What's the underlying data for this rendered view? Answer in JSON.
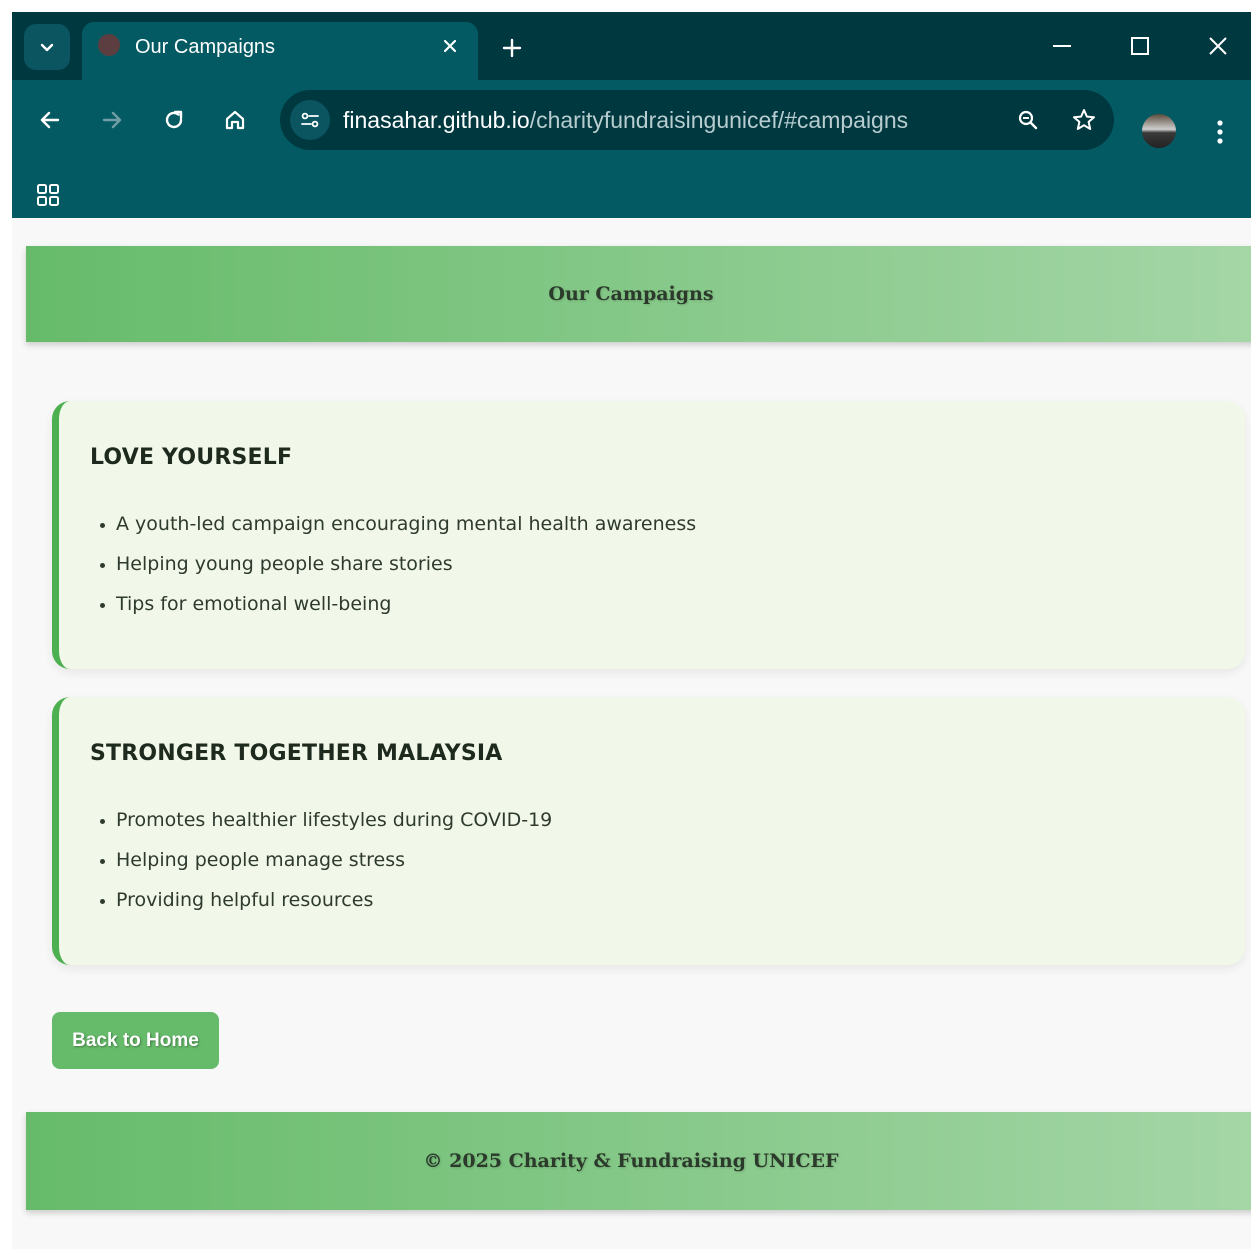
{
  "browser": {
    "tab_title": "Our Campaigns",
    "url_host": "finasahar.github.io",
    "url_path": "/charityfundraisingunicef/#campaigns"
  },
  "page": {
    "header_title": "Our Campaigns",
    "campaigns": [
      {
        "title": "LOVE YOURSELF",
        "points": [
          "A youth-led campaign encouraging mental health awareness",
          "Helping young people share stories",
          "Tips for emotional well-being"
        ]
      },
      {
        "title": "STRONGER TOGETHER MALAYSIA",
        "points": [
          "Promotes healthier lifestyles during COVID-19",
          "Helping people manage stress",
          "Providing helpful resources"
        ]
      }
    ],
    "back_button_label": "Back to Home",
    "footer_text": "© 2025 Charity & Fundraising UNICEF"
  },
  "colors": {
    "chrome_dark": "#003840",
    "chrome_teal": "#045a63",
    "brand_green": "#66bb6a",
    "brand_green_light": "#a5d6a7",
    "card_bg": "#f1f8e9",
    "card_border": "#4caf50"
  },
  "icons": [
    "tab-search-icon",
    "globe-icon",
    "close-icon",
    "plus-icon",
    "minimize-icon",
    "maximize-icon",
    "back-arrow-icon",
    "forward-arrow-icon",
    "reload-icon",
    "home-icon",
    "site-settings-icon",
    "zoom-icon",
    "star-icon",
    "menu-dots-icon",
    "apps-grid-icon"
  ]
}
